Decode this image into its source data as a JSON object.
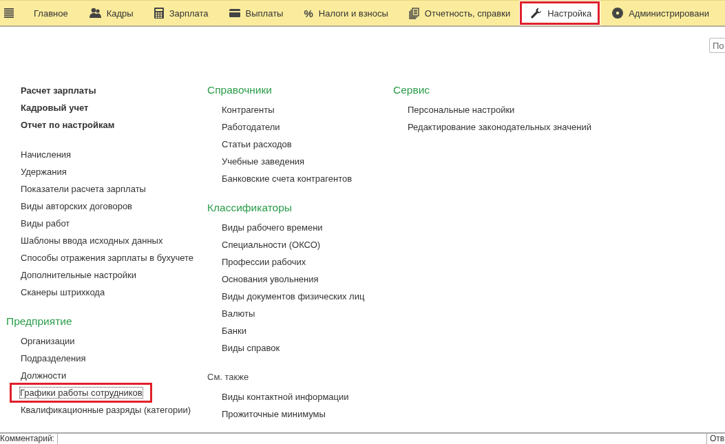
{
  "nav": {
    "tabs": [
      {
        "label": "Главное",
        "selected": false,
        "highlighted": false
      },
      {
        "label": "Кадры",
        "selected": false,
        "highlighted": false
      },
      {
        "label": "Зарплата",
        "selected": false,
        "highlighted": false
      },
      {
        "label": "Выплаты",
        "selected": false,
        "highlighted": false
      },
      {
        "label": "Налоги и взносы",
        "symbol": "%",
        "selected": false,
        "highlighted": false
      },
      {
        "label": "Отчетность, справки",
        "selected": false,
        "highlighted": false
      },
      {
        "label": "Настройка",
        "selected": true,
        "highlighted": true
      },
      {
        "label": "Администрировани",
        "selected": false,
        "highlighted": false
      }
    ]
  },
  "search": {
    "placeholder": "По"
  },
  "columns": [
    {
      "sections": [
        {
          "strong": true,
          "items": [
            {
              "label": "Расчет зарплаты",
              "highlighted": false,
              "focused": false
            },
            {
              "label": "Кадровый учет",
              "highlighted": false,
              "focused": false
            },
            {
              "label": "Отчет по настройкам",
              "highlighted": false,
              "focused": false
            }
          ]
        },
        {
          "strong": false,
          "items": [
            {
              "label": "Начисления",
              "highlighted": false,
              "focused": false
            },
            {
              "label": "Удержания",
              "highlighted": false,
              "focused": false
            },
            {
              "label": "Показатели расчета зарплаты",
              "highlighted": false,
              "focused": false
            },
            {
              "label": "Виды авторских договоров",
              "highlighted": false,
              "focused": false
            },
            {
              "label": "Виды работ",
              "highlighted": false,
              "focused": false
            },
            {
              "label": "Шаблоны ввода исходных данных",
              "highlighted": false,
              "focused": false
            },
            {
              "label": "Способы отражения зарплаты в бухучете",
              "highlighted": false,
              "focused": false
            },
            {
              "label": "Дополнительные настройки",
              "highlighted": false,
              "focused": false
            },
            {
              "label": "Сканеры штрихкода",
              "highlighted": false,
              "focused": false
            }
          ]
        },
        {
          "title": "Предприятие",
          "kind": "heading",
          "strong": false,
          "items": [
            {
              "label": "Организации",
              "highlighted": false,
              "focused": false
            },
            {
              "label": "Подразделения",
              "highlighted": false,
              "focused": false
            },
            {
              "label": "Должности",
              "highlighted": false,
              "focused": false
            },
            {
              "label": "Графики работы сотрудников",
              "highlighted": true,
              "focused": true
            },
            {
              "label": "Квалификационные разряды (категории)",
              "highlighted": false,
              "focused": false
            }
          ]
        }
      ]
    },
    {
      "sections": [
        {
          "title": "Справочники",
          "kind": "heading",
          "strong": false,
          "items": [
            {
              "label": "Контрагенты",
              "highlighted": false,
              "focused": false
            },
            {
              "label": "Работодатели",
              "highlighted": false,
              "focused": false
            },
            {
              "label": "Статьи расходов",
              "highlighted": false,
              "focused": false
            },
            {
              "label": "Учебные заведения",
              "highlighted": false,
              "focused": false
            },
            {
              "label": "Банковские счета контрагентов",
              "highlighted": false,
              "focused": false
            }
          ]
        },
        {
          "title": "Классификаторы",
          "kind": "heading",
          "strong": false,
          "items": [
            {
              "label": "Виды рабочего времени",
              "highlighted": false,
              "focused": false
            },
            {
              "label": "Специальности (ОКСО)",
              "highlighted": false,
              "focused": false
            },
            {
              "label": "Профессии рабочих",
              "highlighted": false,
              "focused": false
            },
            {
              "label": "Основания увольнения",
              "highlighted": false,
              "focused": false
            },
            {
              "label": "Виды документов физических лиц",
              "highlighted": false,
              "focused": false
            },
            {
              "label": "Валюты",
              "highlighted": false,
              "focused": false
            },
            {
              "label": "Банки",
              "highlighted": false,
              "focused": false
            },
            {
              "label": "Виды справок",
              "highlighted": false,
              "focused": false
            }
          ]
        },
        {
          "title": "См. также",
          "kind": "note",
          "strong": false,
          "items": [
            {
              "label": "Виды контактной информации",
              "highlighted": false,
              "focused": false
            },
            {
              "label": "Прожиточные минимумы",
              "highlighted": false,
              "focused": false
            }
          ]
        }
      ]
    },
    {
      "sections": [
        {
          "title": "Сервис",
          "kind": "heading",
          "strong": false,
          "items": [
            {
              "label": "Персональные настройки",
              "highlighted": false,
              "focused": false
            },
            {
              "label": "Редактирование законодательных значений",
              "highlighted": false,
              "focused": false
            }
          ]
        }
      ]
    }
  ],
  "status_bar": {
    "comment_label": "Комментарий:",
    "right_label": "Отв"
  }
}
